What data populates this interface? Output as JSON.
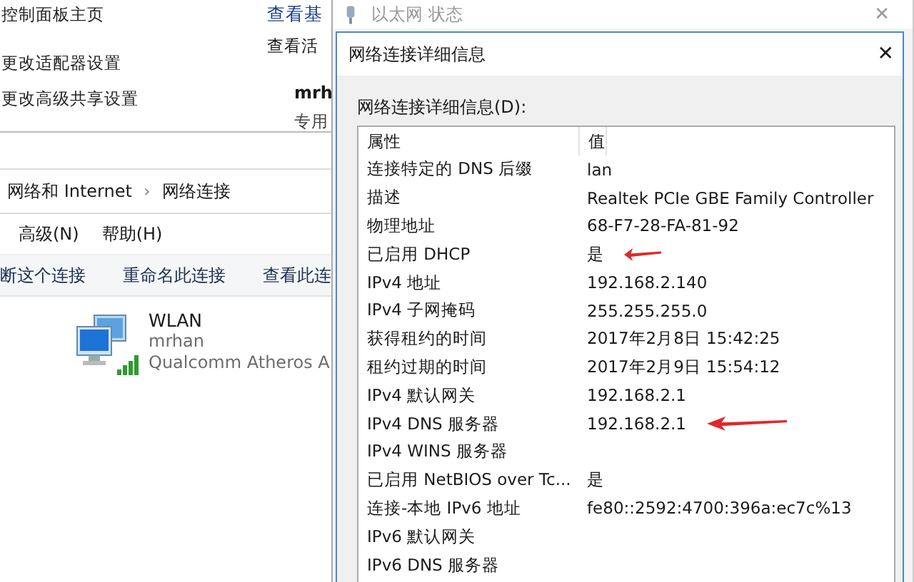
{
  "back_window": {
    "sidebar_links": [
      "控制面板主页",
      "更改适配器设置",
      "更改高级共享设置"
    ],
    "heading": "查看基",
    "subheading": "查看活",
    "network_name": "mrh",
    "network_type": "专用"
  },
  "explorer": {
    "breadcrumb": [
      "网络和 Internet",
      "网络连接"
    ],
    "separator": "›",
    "menu": [
      "高级(N)",
      "帮助(H)"
    ],
    "toolbar": [
      "断这个连接",
      "重命名此连接",
      "查看此连"
    ],
    "connection": {
      "name": "WLAN",
      "network": "mrhan",
      "adapter": "Qualcomm Atheros A"
    }
  },
  "status_dialog": {
    "title": "以太网 状态",
    "close": "✕"
  },
  "details_dialog": {
    "title": "网络连接详细信息",
    "close": "✕",
    "label": "网络连接详细信息(D):",
    "columns": [
      "属性",
      "值"
    ],
    "rows": [
      {
        "property": "连接特定的 DNS 后缀",
        "value": "lan",
        "marked": false
      },
      {
        "property": "描述",
        "value": "Realtek PCIe GBE Family Controller",
        "marked": false
      },
      {
        "property": "物理地址",
        "value": "68-F7-28-FA-81-92",
        "marked": false
      },
      {
        "property": "已启用 DHCP",
        "value": "是",
        "marked": true
      },
      {
        "property": "IPv4 地址",
        "value": "192.168.2.140",
        "marked": false
      },
      {
        "property": "IPv4 子网掩码",
        "value": "255.255.255.0",
        "marked": false
      },
      {
        "property": "获得租约的时间",
        "value": "2017年2月8日 15:42:25",
        "marked": false
      },
      {
        "property": "租约过期的时间",
        "value": "2017年2月9日 15:54:12",
        "marked": false
      },
      {
        "property": "IPv4 默认网关",
        "value": "192.168.2.1",
        "marked": false
      },
      {
        "property": "IPv4 DNS 服务器",
        "value": "192.168.2.1",
        "marked": true
      },
      {
        "property": "IPv4 WINS 服务器",
        "value": "",
        "marked": false
      },
      {
        "property": "已启用 NetBIOS over Tc...",
        "value": "是",
        "marked": false
      },
      {
        "property": "连接-本地 IPv6 地址",
        "value": "fe80::2592:4700:396a:ec7c%13",
        "marked": false
      },
      {
        "property": "IPv6 默认网关",
        "value": "",
        "marked": false
      },
      {
        "property": "IPv6 DNS 服务器",
        "value": "",
        "marked": false
      }
    ]
  }
}
